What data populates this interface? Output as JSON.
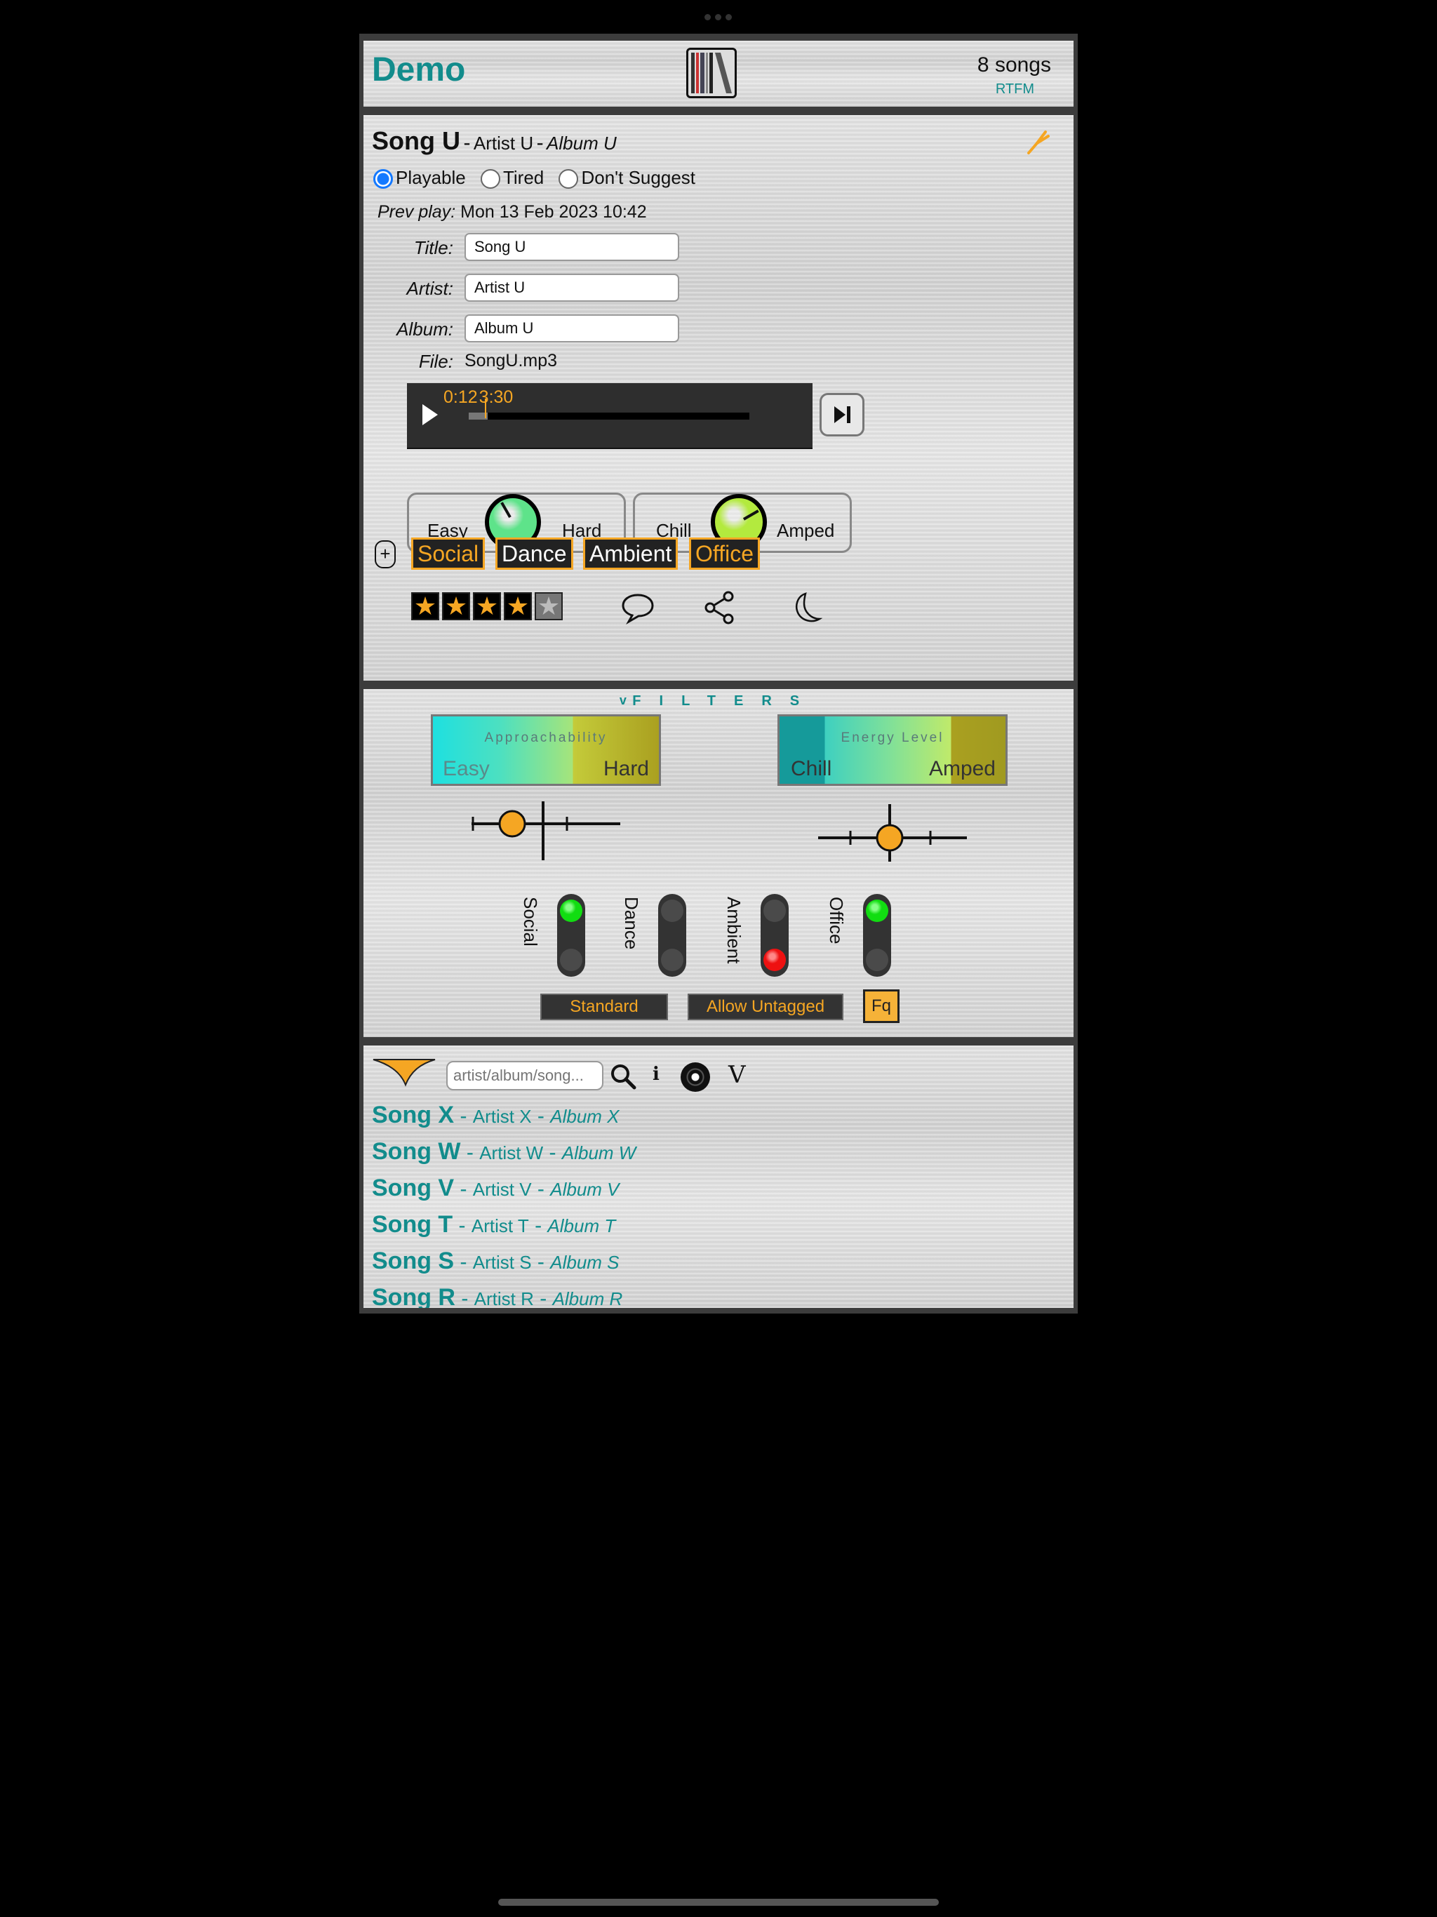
{
  "header": {
    "title": "Demo",
    "song_count": "8 songs",
    "rtfm": "RTFM"
  },
  "song": {
    "title": "Song U",
    "sep1": "-",
    "artist": "Artist U",
    "sep2": "-",
    "album": "Album U",
    "status_options": [
      {
        "label": "Playable",
        "selected": true
      },
      {
        "label": "Tired",
        "selected": false
      },
      {
        "label": "Don't Suggest",
        "selected": false
      }
    ],
    "prev_play_label": "Prev play:",
    "prev_play_value": "Mon 13 Feb 2023 10:42",
    "fields": {
      "title_label": "Title:",
      "title_value": "Song U",
      "artist_label": "Artist:",
      "artist_value": "Artist U",
      "album_label": "Album:",
      "album_value": "Album U",
      "file_label": "File:",
      "file_value": "SongU.mp3"
    },
    "player": {
      "position": "0:12",
      "duration": "3:30",
      "progress_fraction": 0.057
    },
    "dials": [
      {
        "left": "Easy",
        "right": "Hard",
        "color": "#5ee38a"
      },
      {
        "left": "Chill",
        "right": "Amped",
        "color": "#b3ea3e"
      }
    ],
    "tags": [
      {
        "label": "Social",
        "active": true
      },
      {
        "label": "Dance",
        "active": false
      },
      {
        "label": "Ambient",
        "active": false
      },
      {
        "label": "Office",
        "active": true
      }
    ],
    "rating": 4,
    "rating_max": 5,
    "accent_color": "#f5a623"
  },
  "filters": {
    "title": "FILTERS",
    "toggle_glyph": "v",
    "approachability": {
      "label": "Approachability",
      "low": "Easy",
      "high": "Hard"
    },
    "energy": {
      "label": "Energy Level",
      "low": "Chill",
      "high": "Amped"
    },
    "toggles": [
      {
        "label": "Social",
        "state": "on"
      },
      {
        "label": "Dance",
        "state": "neutral"
      },
      {
        "label": "Ambient",
        "state": "off"
      },
      {
        "label": "Office",
        "state": "on"
      }
    ],
    "buttons": {
      "standard": "Standard",
      "allow_untagged": "Allow Untagged",
      "fq": "Fq"
    }
  },
  "list": {
    "search_placeholder": "artist/album/song...",
    "info_glyph": "i",
    "v_glyph": "V",
    "songs": [
      {
        "title": "Song X",
        "artist": "Artist X",
        "album": "Album X"
      },
      {
        "title": "Song W",
        "artist": "Artist W",
        "album": "Album W"
      },
      {
        "title": "Song V",
        "artist": "Artist V",
        "album": "Album V"
      },
      {
        "title": "Song T",
        "artist": "Artist T",
        "album": "Album T"
      },
      {
        "title": "Song S",
        "artist": "Artist S",
        "album": "Album S"
      },
      {
        "title": "Song R",
        "artist": "Artist R",
        "album": "Album R"
      }
    ]
  }
}
